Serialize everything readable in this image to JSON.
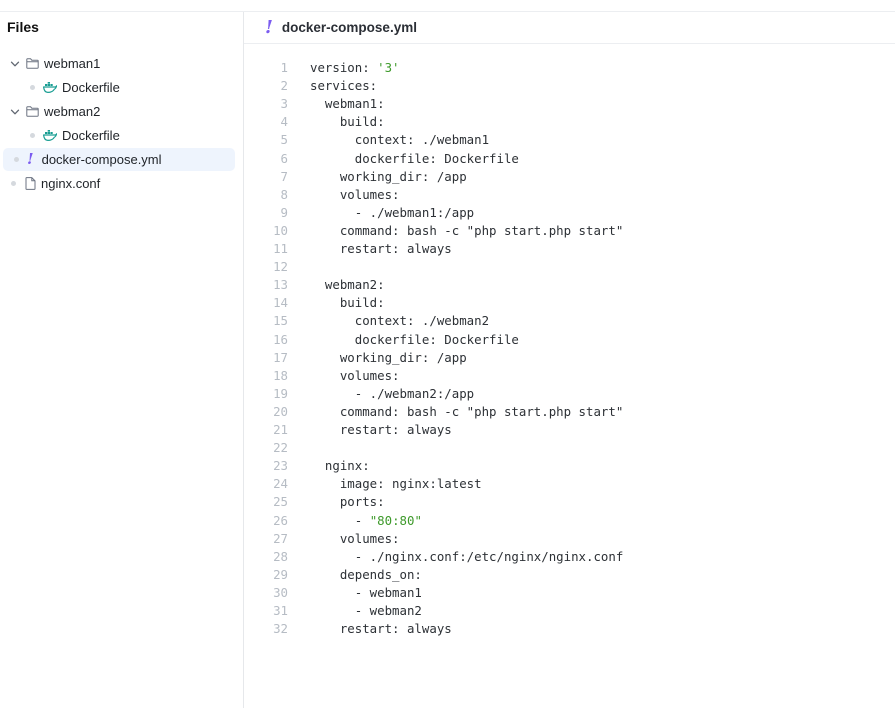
{
  "sidebar": {
    "title": "Files",
    "items": [
      {
        "label": "webman1",
        "type": "folder",
        "expanded": true,
        "depth": 0,
        "icon": "folder-icon"
      },
      {
        "label": "Dockerfile",
        "type": "file",
        "depth": 1,
        "icon": "docker-icon"
      },
      {
        "label": "webman2",
        "type": "folder",
        "expanded": true,
        "depth": 0,
        "icon": "folder-icon"
      },
      {
        "label": "Dockerfile",
        "type": "file",
        "depth": 1,
        "icon": "docker-icon"
      },
      {
        "label": "docker-compose.yml",
        "type": "file",
        "depth": 0,
        "icon": "yaml-exclamation-icon",
        "selected": true
      },
      {
        "label": "nginx.conf",
        "type": "file",
        "depth": 0,
        "icon": "file-icon"
      }
    ]
  },
  "editor": {
    "title": "docker-compose.yml",
    "lines": [
      "version: '3'",
      "services:",
      "  webman1:",
      "    build:",
      "      context: ./webman1",
      "      dockerfile: Dockerfile",
      "    working_dir: /app",
      "    volumes:",
      "      - ./webman1:/app",
      "    command: bash -c \"php start.php start\"",
      "    restart: always",
      "",
      "  webman2:",
      "    build:",
      "      context: ./webman2",
      "      dockerfile: Dockerfile",
      "    working_dir: /app",
      "    volumes:",
      "      - ./webman2:/app",
      "    command: bash -c \"php start.php start\"",
      "    restart: always",
      "",
      "  nginx:",
      "    image: nginx:latest",
      "    ports:",
      "      - \"80:80\"",
      "    volumes:",
      "      - ./nginx.conf:/etc/nginx/nginx.conf",
      "    depends_on:",
      "      - webman1",
      "      - webman2",
      "    restart: always"
    ]
  },
  "colors": {
    "accent": "#7b5cf0",
    "docker": "#1a9e93",
    "string": "#3e9a2b",
    "selected_bg": "#eef4fd"
  }
}
